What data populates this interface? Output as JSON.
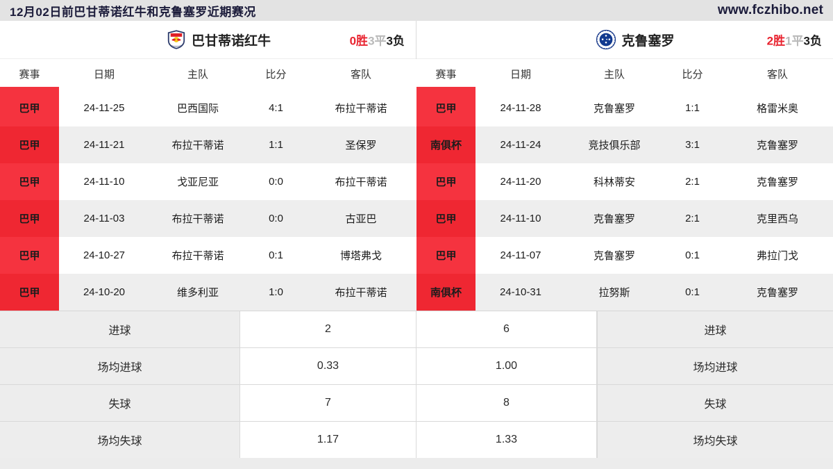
{
  "header": {
    "title": "12月02日前巴甘蒂诺红牛和克鲁塞罗近期赛况",
    "site": "www.fczhibo.net"
  },
  "left_panel": {
    "team": {
      "name": "巴甘蒂诺红牛",
      "logo": "red-bull-bragantino-crest",
      "record": {
        "wins": "0胜",
        "draws": "3平",
        "losses": "3负"
      }
    },
    "columns": [
      "赛事",
      "日期",
      "主队",
      "比分",
      "客队"
    ],
    "matches": [
      {
        "league": "巴甲",
        "date": "24-11-25",
        "home": "巴西国际",
        "score": "4:1",
        "away": "布拉干蒂诺"
      },
      {
        "league": "巴甲",
        "date": "24-11-21",
        "home": "布拉干蒂诺",
        "score": "1:1",
        "away": "圣保罗"
      },
      {
        "league": "巴甲",
        "date": "24-11-10",
        "home": "戈亚尼亚",
        "score": "0:0",
        "away": "布拉干蒂诺"
      },
      {
        "league": "巴甲",
        "date": "24-11-03",
        "home": "布拉干蒂诺",
        "score": "0:0",
        "away": "古亚巴"
      },
      {
        "league": "巴甲",
        "date": "24-10-27",
        "home": "布拉干蒂诺",
        "score": "0:1",
        "away": "博塔弗戈"
      },
      {
        "league": "巴甲",
        "date": "24-10-20",
        "home": "维多利亚",
        "score": "1:0",
        "away": "布拉干蒂诺"
      }
    ]
  },
  "right_panel": {
    "team": {
      "name": "克鲁塞罗",
      "logo": "cruzeiro-crest",
      "record": {
        "wins": "2胜",
        "draws": "1平",
        "losses": "3负"
      }
    },
    "columns": [
      "赛事",
      "日期",
      "主队",
      "比分",
      "客队"
    ],
    "matches": [
      {
        "league": "巴甲",
        "date": "24-11-28",
        "home": "克鲁塞罗",
        "score": "1:1",
        "away": "格雷米奥"
      },
      {
        "league": "南俱杯",
        "date": "24-11-24",
        "home": "竞技俱乐部",
        "score": "3:1",
        "away": "克鲁塞罗"
      },
      {
        "league": "巴甲",
        "date": "24-11-20",
        "home": "科林蒂安",
        "score": "2:1",
        "away": "克鲁塞罗"
      },
      {
        "league": "巴甲",
        "date": "24-11-10",
        "home": "克鲁塞罗",
        "score": "2:1",
        "away": "克里西乌"
      },
      {
        "league": "巴甲",
        "date": "24-11-07",
        "home": "克鲁塞罗",
        "score": "0:1",
        "away": "弗拉门戈"
      },
      {
        "league": "南俱杯",
        "date": "24-10-31",
        "home": "拉努斯",
        "score": "0:1",
        "away": "克鲁塞罗"
      }
    ]
  },
  "stats": [
    {
      "label_left": "进球",
      "left": "2",
      "right": "6",
      "label_right": "进球"
    },
    {
      "label_left": "场均进球",
      "left": "0.33",
      "right": "1.00",
      "label_right": "场均进球"
    },
    {
      "label_left": "失球",
      "left": "7",
      "right": "8",
      "label_right": "失球"
    },
    {
      "label_left": "场均失球",
      "left": "1.17",
      "right": "1.33",
      "label_right": "场均失球"
    }
  ],
  "colors": {
    "accent_red": "#f2333e",
    "badge_red_odd": "#f5333f",
    "badge_red_even": "#ef2732",
    "win_red": "#e8232f",
    "draw_gray": "#b9b9b9",
    "lose_black": "#1c1c1c"
  }
}
